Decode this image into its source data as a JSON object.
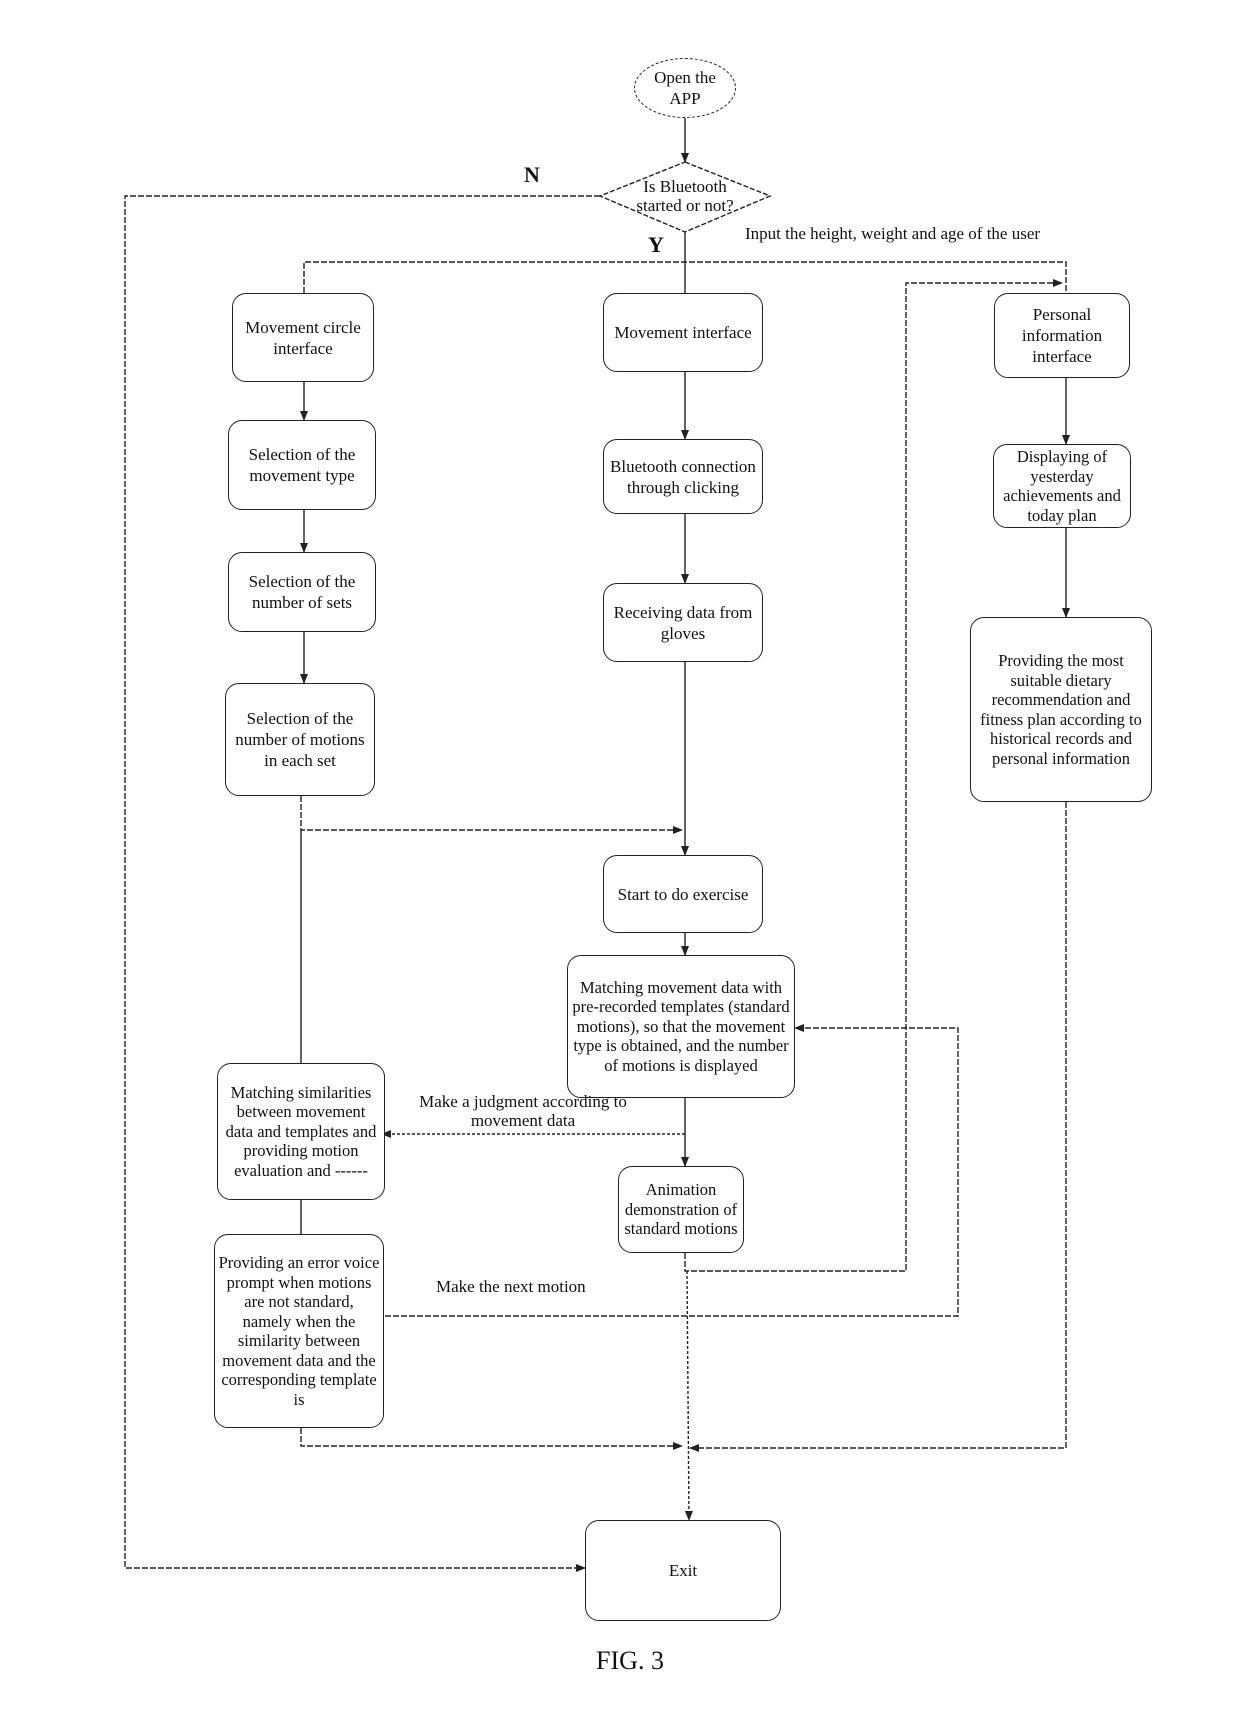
{
  "figure_label": "FIG. 3",
  "nodes": {
    "start": "Open the APP",
    "decision": "Is Bluetooth started or not?",
    "movement_circle": "Movement circle interface",
    "select_type": "Selection of the movement type",
    "select_sets": "Selection of the number of sets",
    "select_motions": "Selection of the number of motions in each set",
    "movement_interface": "Movement interface",
    "bluetooth_connect": "Bluetooth connection through clicking",
    "receive_data": "Receiving data from gloves",
    "start_exercise": "Start to do exercise",
    "matching_templates": "Matching movement data with pre-recorded templates (standard motions), so that the movement type is obtained, and the number of motions is displayed",
    "matching_similarities": "Matching similarities between movement data and templates and providing motion evaluation and ------",
    "animation": "Animation demonstration of standard motions",
    "error_prompt": "Providing an error voice prompt when motions are not standard, namely when the similarity between movement data and the corresponding template is",
    "personal_info": "Personal information interface",
    "display_achievements": "Displaying of yesterday achievements and today plan",
    "recommendation": "Providing the most suitable dietary recommendation and fitness plan according to historical records and personal information",
    "exit": "Exit"
  },
  "edge_labels": {
    "no": "N",
    "yes": "Y",
    "input_user": "Input the height, weight and age of the user",
    "judgment": "Make a judgment according to movement data",
    "next_motion": "Make the next motion"
  },
  "colors": {
    "line": "#222222",
    "background": "#ffffff"
  }
}
